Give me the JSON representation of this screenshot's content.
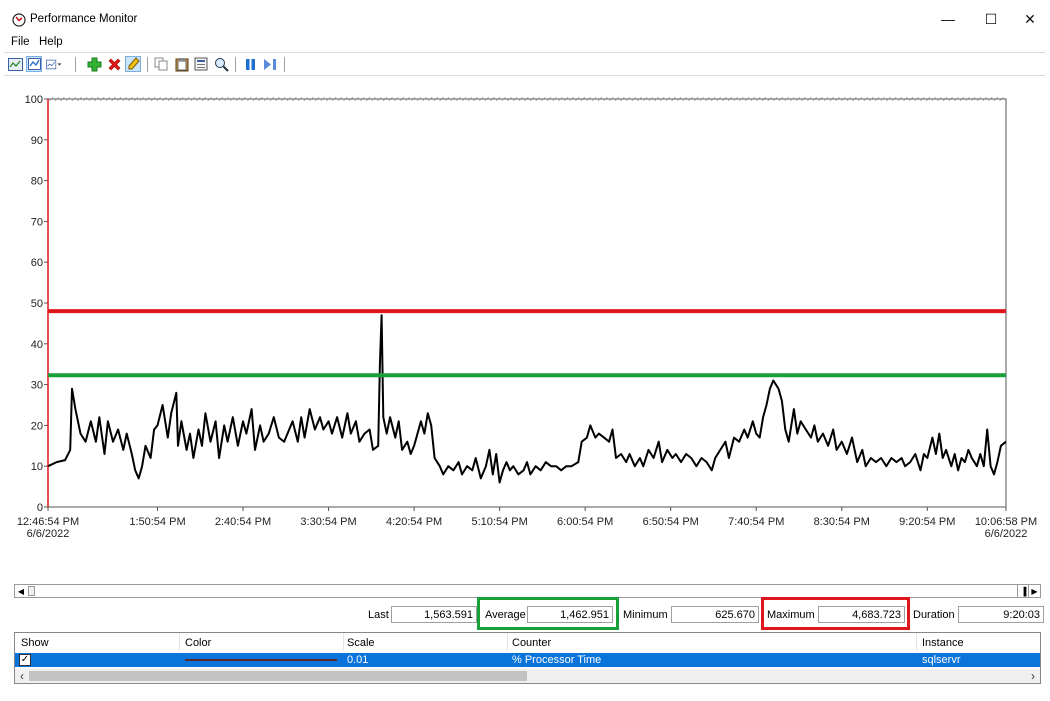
{
  "window": {
    "title": "Performance Monitor",
    "minimize_glyph": "—",
    "maximize_glyph": "☐",
    "close_glyph": "✕"
  },
  "menu": {
    "items": [
      "File",
      "Help"
    ]
  },
  "toolbar": {
    "icons": [
      "view-current-activity-icon",
      "change-graph-type-icon",
      "graph-type-dropdown-icon",
      "add-counter-icon",
      "delete-counter-icon",
      "highlight-icon",
      "copy-properties-icon",
      "paste-counter-list-icon",
      "properties-icon",
      "zoom-icon",
      "freeze-display-icon",
      "update-data-icon"
    ]
  },
  "chart_data": {
    "type": "line",
    "y_ticks": [
      "0",
      "10",
      "20",
      "30",
      "40",
      "50",
      "60",
      "70",
      "80",
      "90",
      "100"
    ],
    "ylim": [
      0,
      100
    ],
    "x_labels": [
      {
        "line1": "12:46:54 PM",
        "line2": "6/6/2022"
      },
      {
        "line1": "1:50:54 PM",
        "line2": ""
      },
      {
        "line1": "2:40:54 PM",
        "line2": ""
      },
      {
        "line1": "3:30:54 PM",
        "line2": ""
      },
      {
        "line1": "4:20:54 PM",
        "line2": ""
      },
      {
        "line1": "5:10:54 PM",
        "line2": ""
      },
      {
        "line1": "6:00:54 PM",
        "line2": ""
      },
      {
        "line1": "6:50:54 PM",
        "line2": ""
      },
      {
        "line1": "7:40:54 PM",
        "line2": ""
      },
      {
        "line1": "8:30:54 PM",
        "line2": ""
      },
      {
        "line1": "9:20:54 PM",
        "line2": ""
      },
      {
        "line1": "10:06:58 PM",
        "line2": "6/6/2022"
      }
    ],
    "x_minutes": [
      0,
      64,
      114,
      164,
      214,
      264,
      314,
      364,
      414,
      464,
      514,
      560
    ],
    "reference_lines": [
      {
        "value": 48,
        "color": "#e0161e"
      },
      {
        "value": 32.3,
        "color": "#1a9e3a"
      }
    ],
    "series": [
      {
        "color": "#000000",
        "points": [
          [
            0,
            10
          ],
          [
            5,
            11
          ],
          [
            10,
            11.5
          ],
          [
            13,
            14
          ],
          [
            14,
            29
          ],
          [
            16,
            24
          ],
          [
            19,
            18
          ],
          [
            22,
            16
          ],
          [
            25,
            21
          ],
          [
            28,
            16
          ],
          [
            30,
            22
          ],
          [
            33,
            13
          ],
          [
            35,
            21
          ],
          [
            38,
            16
          ],
          [
            41,
            19
          ],
          [
            44,
            14
          ],
          [
            46,
            18
          ],
          [
            49,
            13
          ],
          [
            51,
            9
          ],
          [
            53,
            7
          ],
          [
            55,
            10
          ],
          [
            57,
            15
          ],
          [
            60,
            12
          ],
          [
            62,
            19
          ],
          [
            64,
            20
          ],
          [
            67,
            25
          ],
          [
            70,
            17
          ],
          [
            72,
            23
          ],
          [
            75,
            28
          ],
          [
            76,
            15
          ],
          [
            78,
            21
          ],
          [
            81,
            14
          ],
          [
            83,
            18
          ],
          [
            85,
            12
          ],
          [
            88,
            19
          ],
          [
            90,
            15
          ],
          [
            92,
            23
          ],
          [
            95,
            16
          ],
          [
            98,
            21
          ],
          [
            100,
            12
          ],
          [
            103,
            20
          ],
          [
            105,
            16
          ],
          [
            108,
            22
          ],
          [
            111,
            15
          ],
          [
            114,
            21
          ],
          [
            116,
            18
          ],
          [
            119,
            24
          ],
          [
            121,
            14
          ],
          [
            124,
            20
          ],
          [
            126,
            16
          ],
          [
            129,
            18
          ],
          [
            132,
            22
          ],
          [
            135,
            17
          ],
          [
            138,
            16
          ],
          [
            140,
            18
          ],
          [
            143,
            21
          ],
          [
            146,
            16
          ],
          [
            148,
            22
          ],
          [
            150,
            17
          ],
          [
            153,
            24
          ],
          [
            156,
            19
          ],
          [
            159,
            22
          ],
          [
            161,
            19
          ],
          [
            164,
            21
          ],
          [
            166,
            18
          ],
          [
            169,
            22
          ],
          [
            172,
            17
          ],
          [
            175,
            23
          ],
          [
            177,
            18
          ],
          [
            180,
            21
          ],
          [
            182,
            16
          ],
          [
            185,
            18
          ],
          [
            188,
            19
          ],
          [
            190,
            14
          ],
          [
            193,
            15
          ],
          [
            194,
            35
          ],
          [
            195,
            47
          ],
          [
            196,
            22
          ],
          [
            198,
            18
          ],
          [
            200,
            22
          ],
          [
            203,
            17
          ],
          [
            205,
            21
          ],
          [
            207,
            14
          ],
          [
            210,
            16
          ],
          [
            212,
            13
          ],
          [
            214,
            15
          ],
          [
            216,
            18
          ],
          [
            218,
            21
          ],
          [
            220,
            18
          ],
          [
            222,
            23
          ],
          [
            224,
            20
          ],
          [
            226,
            12
          ],
          [
            229,
            10
          ],
          [
            231,
            8
          ],
          [
            234,
            10
          ],
          [
            237,
            9
          ],
          [
            240,
            11
          ],
          [
            242,
            8
          ],
          [
            245,
            10
          ],
          [
            248,
            9
          ],
          [
            250,
            12
          ],
          [
            253,
            7
          ],
          [
            256,
            10
          ],
          [
            258,
            14
          ],
          [
            260,
            8
          ],
          [
            262,
            13
          ],
          [
            264,
            6
          ],
          [
            266,
            9
          ],
          [
            268,
            11
          ],
          [
            270,
            9
          ],
          [
            272,
            10
          ],
          [
            275,
            8
          ],
          [
            278,
            9
          ],
          [
            280,
            11
          ],
          [
            282,
            8
          ],
          [
            285,
            10
          ],
          [
            288,
            9
          ],
          [
            291,
            11
          ],
          [
            294,
            10
          ],
          [
            297,
            10
          ],
          [
            300,
            9
          ],
          [
            303,
            10
          ],
          [
            306,
            10
          ],
          [
            310,
            11
          ],
          [
            312,
            16
          ],
          [
            315,
            17
          ],
          [
            317,
            20
          ],
          [
            320,
            17
          ],
          [
            322,
            18
          ],
          [
            325,
            17
          ],
          [
            328,
            16
          ],
          [
            330,
            19
          ],
          [
            332,
            12
          ],
          [
            335,
            13
          ],
          [
            338,
            11
          ],
          [
            340,
            13
          ],
          [
            343,
            10
          ],
          [
            346,
            12
          ],
          [
            348,
            10
          ],
          [
            351,
            14
          ],
          [
            354,
            12
          ],
          [
            357,
            16
          ],
          [
            359,
            11
          ],
          [
            362,
            14
          ],
          [
            365,
            12
          ],
          [
            367,
            13
          ],
          [
            370,
            11
          ],
          [
            373,
            13
          ],
          [
            376,
            12
          ],
          [
            379,
            10
          ],
          [
            382,
            12
          ],
          [
            385,
            11
          ],
          [
            388,
            9
          ],
          [
            390,
            12
          ],
          [
            393,
            14
          ],
          [
            396,
            16
          ],
          [
            398,
            12
          ],
          [
            401,
            17
          ],
          [
            404,
            16
          ],
          [
            407,
            19
          ],
          [
            409,
            17
          ],
          [
            412,
            21
          ],
          [
            414,
            18
          ],
          [
            416,
            17
          ],
          [
            418,
            22
          ],
          [
            420,
            25
          ],
          [
            422,
            29
          ],
          [
            424,
            31
          ],
          [
            427,
            29
          ],
          [
            429,
            26
          ],
          [
            431,
            19
          ],
          [
            433,
            16
          ],
          [
            436,
            24
          ],
          [
            438,
            18
          ],
          [
            440,
            21
          ],
          [
            443,
            19
          ],
          [
            446,
            17
          ],
          [
            448,
            20
          ],
          [
            450,
            16
          ],
          [
            453,
            18
          ],
          [
            456,
            15
          ],
          [
            459,
            19
          ],
          [
            461,
            14
          ],
          [
            464,
            16
          ],
          [
            467,
            13
          ],
          [
            470,
            17
          ],
          [
            473,
            11
          ],
          [
            476,
            14
          ],
          [
            478,
            10
          ],
          [
            481,
            12
          ],
          [
            484,
            11
          ],
          [
            487,
            12
          ],
          [
            490,
            10
          ],
          [
            493,
            12
          ],
          [
            496,
            11
          ],
          [
            499,
            12
          ],
          [
            501,
            10
          ],
          [
            504,
            11
          ],
          [
            507,
            13
          ],
          [
            510,
            9
          ],
          [
            512,
            13
          ],
          [
            514,
            12
          ],
          [
            517,
            17
          ],
          [
            519,
            13
          ],
          [
            521,
            18
          ],
          [
            523,
            12
          ],
          [
            525,
            14
          ],
          [
            528,
            10
          ],
          [
            530,
            13
          ],
          [
            532,
            9
          ],
          [
            534,
            12
          ],
          [
            536,
            11
          ],
          [
            538,
            14
          ],
          [
            540,
            12
          ],
          [
            543,
            10
          ],
          [
            545,
            13
          ],
          [
            547,
            10
          ],
          [
            549,
            19
          ],
          [
            551,
            10
          ],
          [
            553,
            8
          ],
          [
            555,
            11
          ],
          [
            557,
            15
          ],
          [
            560,
            16
          ]
        ]
      }
    ]
  },
  "stats": {
    "last_label": "Last",
    "last_value": "1,563.591",
    "average_label": "Average",
    "average_value": "1,462.951",
    "minimum_label": "Minimum",
    "minimum_value": "625.670",
    "maximum_label": "Maximum",
    "maximum_value": "4,683.723",
    "duration_label": "Duration",
    "duration_value": "9:20:03"
  },
  "counters": {
    "columns": [
      "Show",
      "Color",
      "Scale",
      "Counter",
      "Instance"
    ],
    "rows": [
      {
        "show": "✓",
        "scale": "0.01",
        "counter": "% Processor Time",
        "instance": "sqlservr",
        "color": "#5a2a2a"
      }
    ]
  }
}
